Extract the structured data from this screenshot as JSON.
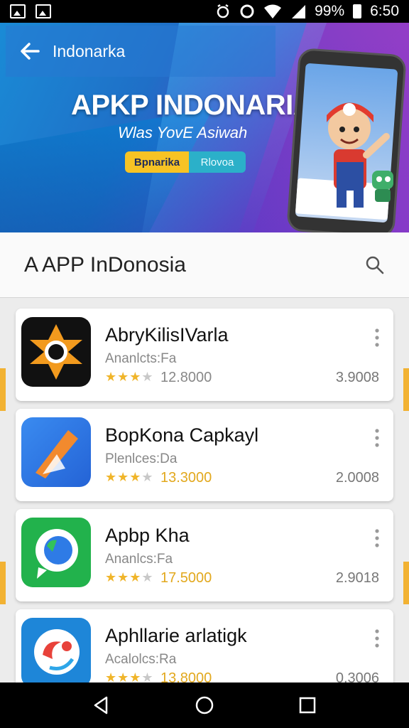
{
  "status_bar": {
    "battery": "99%",
    "time": "6:50"
  },
  "banner": {
    "title": "Indonarka",
    "headline": "APKP INDONARIA",
    "tagline": "Wlas YovE Asiwah",
    "primary_button": "Bpnarika",
    "secondary_button": "Rlovoa"
  },
  "search": {
    "query": "A APP InDonosia"
  },
  "apps": [
    {
      "name": "AbryKilisIVarla",
      "developer": "Ananlcts:Fa",
      "rating": 3,
      "downloads": "12.8000",
      "size": "3.9008",
      "downloads_highlight": false
    },
    {
      "name": "BopKona Capkayl",
      "developer": "Plenlces:Da",
      "rating": 3,
      "downloads": "13.3000",
      "size": "2.0008",
      "downloads_highlight": true
    },
    {
      "name": "Apbp Kha",
      "developer": "Ananlcs:Fa",
      "rating": 3,
      "downloads": "17.5000",
      "size": "2.9018",
      "downloads_highlight": true
    },
    {
      "name": "Aphllarie arlatigk",
      "developer": "Acalolcs:Ra",
      "rating": 3,
      "downloads": "13.8000",
      "size": "0.3006",
      "downloads_highlight": true
    }
  ],
  "colors": {
    "accent_gold": "#f0b52a",
    "banner_blue": "#1f6fc7",
    "banner_purple": "#8a3fc8"
  }
}
